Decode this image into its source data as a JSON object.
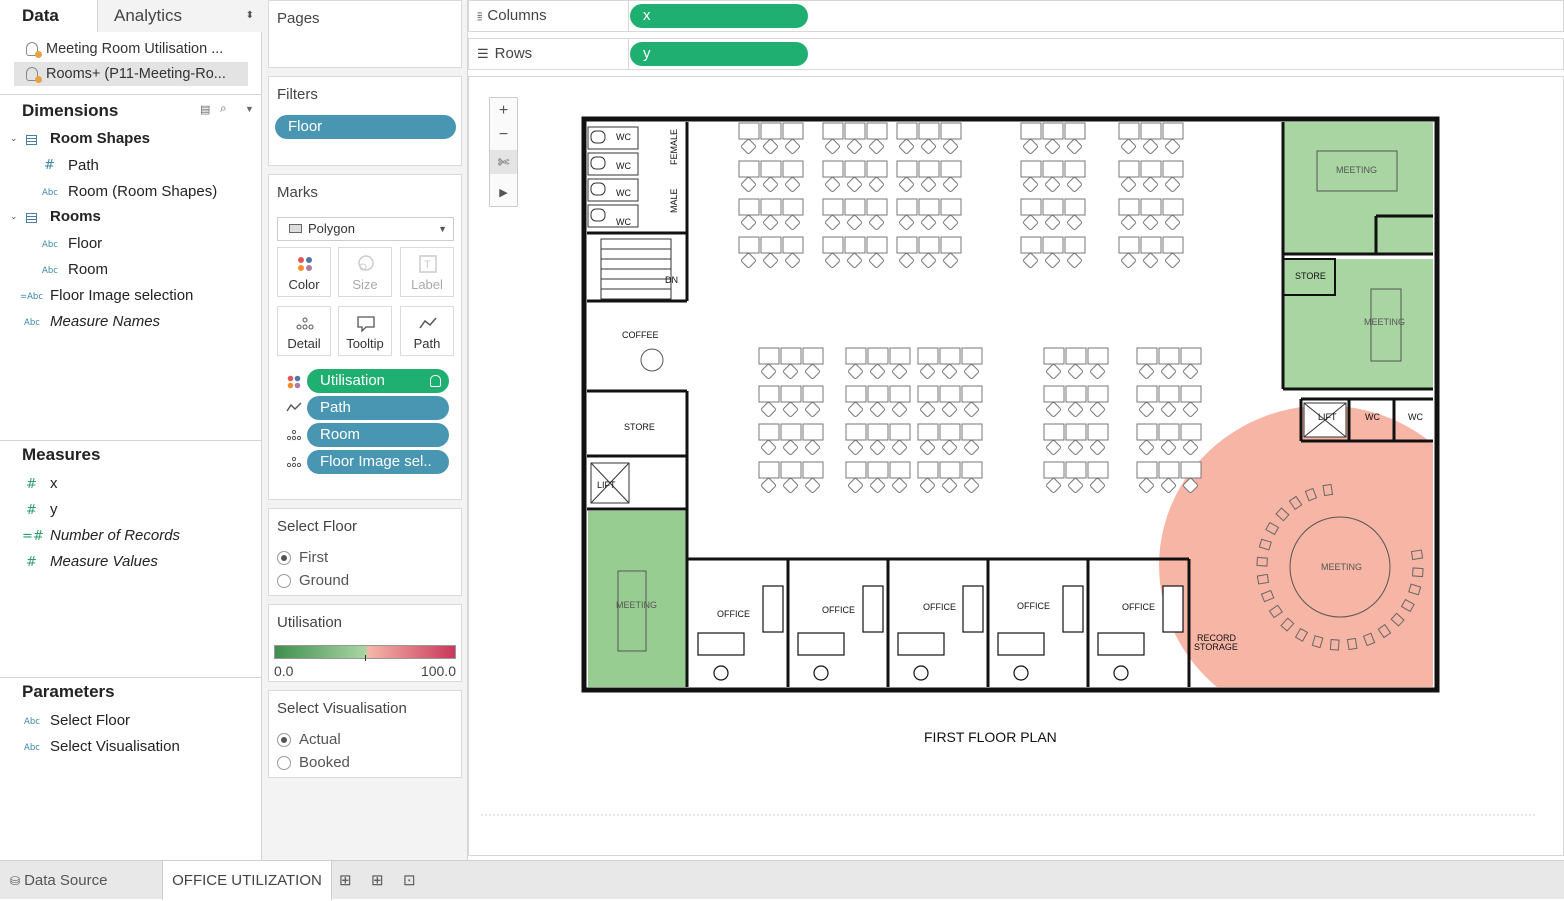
{
  "left_pane": {
    "tabs": {
      "data": "Data",
      "analytics": "Analytics"
    },
    "datasources": [
      "Meeting Room Utilisation ...",
      "Rooms+ (P11-Meeting-Ro..."
    ],
    "dimensions": {
      "title": "Dimensions",
      "groups": [
        {
          "name": "Room Shapes",
          "fields": [
            "Path",
            "Room (Room Shapes)"
          ]
        },
        {
          "name": "Rooms",
          "fields": [
            "Floor",
            "Room"
          ]
        }
      ],
      "extra": [
        "Floor Image selection",
        "Measure Names"
      ]
    },
    "measures": {
      "title": "Measures",
      "fields": [
        "x",
        "y",
        "Number of Records",
        "Measure Values"
      ]
    },
    "parameters": {
      "title": "Parameters",
      "fields": [
        "Select Floor",
        "Select Visualisation"
      ]
    }
  },
  "shelves": {
    "pages": "Pages",
    "filters": {
      "title": "Filters",
      "pill": "Floor"
    },
    "marks": {
      "title": "Marks",
      "type": "Polygon",
      "buttons": [
        "Color",
        "Size",
        "Label",
        "Detail",
        "Tooltip",
        "Path"
      ],
      "pills": [
        "Utilisation",
        "Path",
        "Room",
        "Floor Image sel.."
      ]
    },
    "columns": {
      "label": "Columns",
      "pill": "x"
    },
    "rows": {
      "label": "Rows",
      "pill": "y"
    }
  },
  "select_floor": {
    "title": "Select Floor",
    "options": [
      "First",
      "Ground"
    ],
    "selected": "First"
  },
  "utilisation_legend": {
    "title": "Utilisation",
    "min": "0.0",
    "max": "100.0",
    "colors": [
      "#3e8f4f",
      "#a8d5a2",
      "#f4b6a8",
      "#c8385a"
    ]
  },
  "select_visualisation": {
    "title": "Select Visualisation",
    "options": [
      "Actual",
      "Booked"
    ],
    "selected": "Actual"
  },
  "floor_plan": {
    "caption": "FIRST FLOOR PLAN",
    "labels": {
      "wc": "WC",
      "female": "FEMALE",
      "male": "MALE",
      "dn": "DN",
      "coffee": "COFFEE",
      "store": "STORE",
      "lift": "LIFT",
      "meeting": "MEETING",
      "office": "OFFICE",
      "record_storage_1": "RECORD",
      "record_storage_2": "STORAGE"
    },
    "room_colors": {
      "meeting_top": "#a8d5a2",
      "meeting_right": "#a8d5a2",
      "meeting_left": "#98cd92",
      "meeting_round": "#f7b5a5"
    }
  },
  "bottom_bar": {
    "data_source": "Data Source",
    "sheet": "OFFICE UTILIZATION"
  }
}
